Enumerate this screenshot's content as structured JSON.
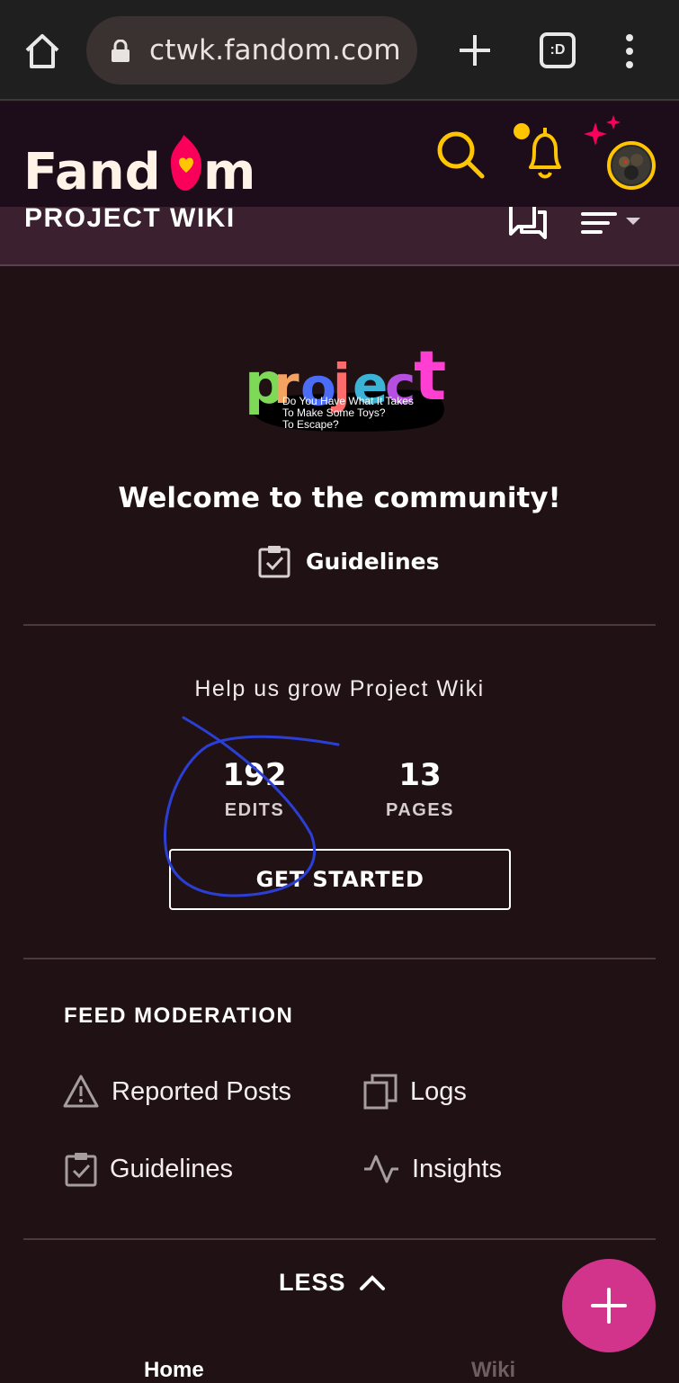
{
  "browser": {
    "url": "ctwk.fandom.com",
    "tabs_count": ":D"
  },
  "header": {
    "brand": "Fandom"
  },
  "wiki_bar": {
    "title": "PROJECT WIKI"
  },
  "community": {
    "logo_word": "project",
    "logo_tagline": [
      "Do You Have What It Takes",
      "To Make Some Toys?",
      "To Escape?"
    ],
    "welcome": "Welcome to the community!",
    "guidelines_label": "Guidelines"
  },
  "growth": {
    "help_text": "Help us grow Project Wiki",
    "edits_value": "192",
    "edits_label": "EDITS",
    "pages_value": "13",
    "pages_label": "PAGES",
    "cta_label": "GET STARTED"
  },
  "feed_moderation": {
    "title": "FEED MODERATION",
    "items": [
      {
        "label": "Reported Posts",
        "icon": "warning-icon"
      },
      {
        "label": "Logs",
        "icon": "logs-icon"
      },
      {
        "label": "Guidelines",
        "icon": "clipboard-check-icon"
      },
      {
        "label": "Insights",
        "icon": "activity-icon"
      }
    ]
  },
  "less_label": "LESS",
  "bottom_tabs": [
    "Home",
    "Wiki"
  ],
  "colors": {
    "background": "#201114",
    "brand_pink": "#fa005a",
    "accent_yellow": "#ffc500",
    "fab": "#d1348a"
  }
}
